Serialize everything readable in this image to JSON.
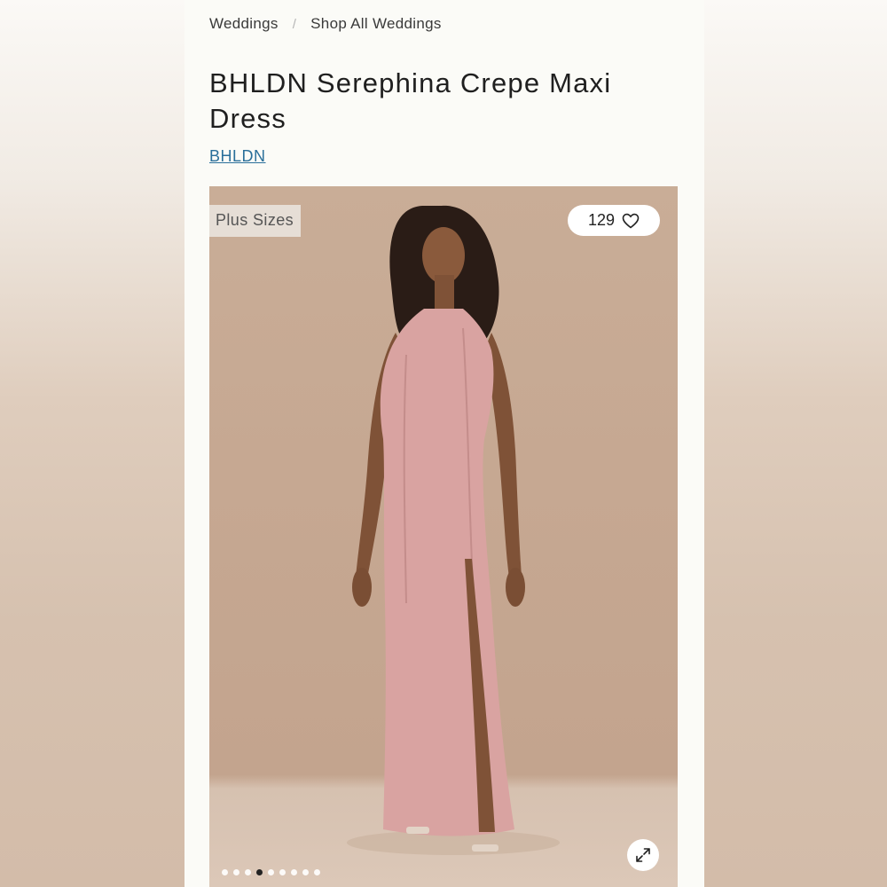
{
  "breadcrumb": {
    "items": [
      "Weddings",
      "Shop All Weddings"
    ],
    "separator": "/"
  },
  "product": {
    "title": "BHLDN Serephina Crepe Maxi Dress",
    "brand": "BHLDN"
  },
  "gallery": {
    "badge": "Plus Sizes",
    "favorites_count": "129",
    "total_images": 9,
    "active_index": 3,
    "icons": {
      "favorite": "heart-icon",
      "expand": "expand-arrows-icon"
    }
  },
  "colors": {
    "link": "#2a6f9a",
    "dress": "#d9a3a1",
    "backdrop": "#c6a892"
  }
}
